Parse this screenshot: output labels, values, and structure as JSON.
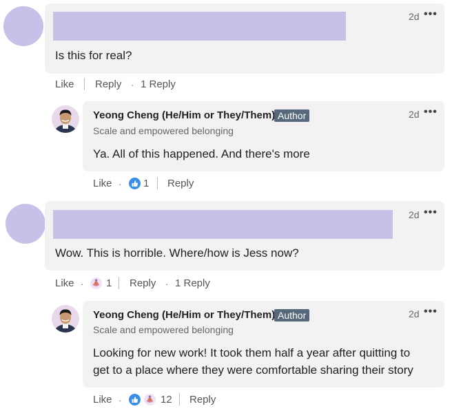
{
  "comments": [
    {
      "time": "2d",
      "text": "Is this for real?",
      "actions": {
        "like": "Like",
        "reply": "Reply",
        "dot": "·",
        "replies": "1 Reply"
      }
    },
    {
      "author": "Yeong Cheng (He/Him or They/Them)",
      "badge": "Author",
      "headline": "Scale and empowered belonging",
      "time": "2d",
      "text": "Ya. All of this happened. And there's more",
      "actions": {
        "like": "Like",
        "dot": "·",
        "reaction_count": "1",
        "reply": "Reply"
      }
    },
    {
      "time": "2d",
      "text": "Wow. This is horrible. Where/how is Jess now?",
      "actions": {
        "like": "Like",
        "dot": "·",
        "reaction_count": "1",
        "reply": "Reply",
        "dot2": "·",
        "replies": "1 Reply"
      }
    },
    {
      "author": "Yeong Cheng (He/Him or They/Them)",
      "badge": "Author",
      "headline": "Scale and empowered belonging",
      "time": "2d",
      "text_line1": "Looking for new work! It took them half a year after quitting to",
      "text_line2": "get to a place where they were comfortable sharing their story",
      "actions": {
        "like": "Like",
        "dot": "·",
        "reaction_count": "12",
        "reply": "Reply"
      }
    }
  ],
  "more_icon": "more-horizontal-icon",
  "reaction_icons": [
    "like-reaction-icon",
    "empathy-reaction-icon"
  ],
  "colors": {
    "placeholder": "#c8c0e8",
    "bubble": "#f2f2f2",
    "badge": "#56687a",
    "like_blue": "#378fe9"
  }
}
